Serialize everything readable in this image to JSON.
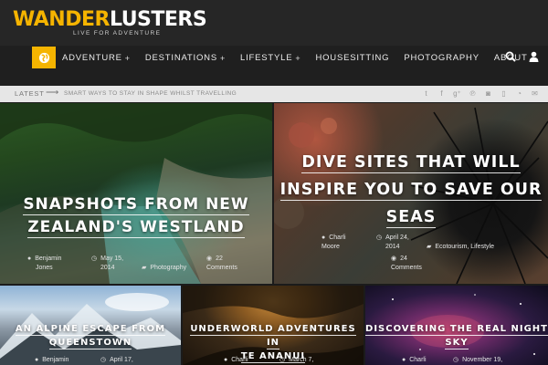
{
  "header": {
    "logo_part1": "WANDER",
    "logo_part2": "LUSTERS",
    "tagline": "LIVE FOR ADVENTURE",
    "accent_color": "#f5b400"
  },
  "nav": {
    "items": [
      {
        "label": "ADVENTURE",
        "has_submenu": true
      },
      {
        "label": "DESTINATIONS",
        "has_submenu": true
      },
      {
        "label": "LIFESTYLE",
        "has_submenu": true
      },
      {
        "label": "HOUSESITTING",
        "has_submenu": false
      },
      {
        "label": "PHOTOGRAPHY",
        "has_submenu": false
      },
      {
        "label": "ABOUT",
        "has_submenu": true
      }
    ],
    "plus": "+"
  },
  "ticker": {
    "label": "LATEST",
    "text": "SMART WAYS TO STAY IN SHAPE WHILST TRAVELLING",
    "social_icons": [
      "twitter-icon",
      "facebook-icon",
      "google-plus-icon",
      "pinterest-icon",
      "instagram-icon",
      "mobile-icon",
      "rss-icon",
      "email-icon"
    ]
  },
  "featured": [
    {
      "title_line1": "SNAPSHOTS FROM NEW",
      "title_line2": "ZEALAND'S WESTLAND",
      "author_first": "Benjamin",
      "author_last": "Jones",
      "date_line1": "May 15,",
      "date_line2": "2014",
      "category": "Photography",
      "comments_count": "22",
      "comments_label": "Comments"
    },
    {
      "title_line1": "DIVE SITES THAT WILL",
      "title_line2": "INSPIRE YOU TO SAVE OUR",
      "title_line3": "SEAS",
      "author_first": "Charli",
      "author_last": "Moore",
      "date_line1": "April 24,",
      "date_line2": "2014",
      "category": "Ecotourism, Lifestyle",
      "comments_count": "24",
      "comments_label": "Comments"
    }
  ],
  "small": [
    {
      "title_line1": "AN ALPINE ESCAPE FROM",
      "title_line2": "QUEENSTOWN",
      "author": "Benjamin",
      "date": "April 17,"
    },
    {
      "title_line1": "UNDERWORLD ADVENTURES IN",
      "title_line2": "TE ANANUI",
      "author": "Charli",
      "date": "March 7,"
    },
    {
      "title_line1": "DISCOVERING THE REAL NIGHT",
      "title_line2": "SKY",
      "author": "Charli",
      "date": "November 19,"
    }
  ]
}
